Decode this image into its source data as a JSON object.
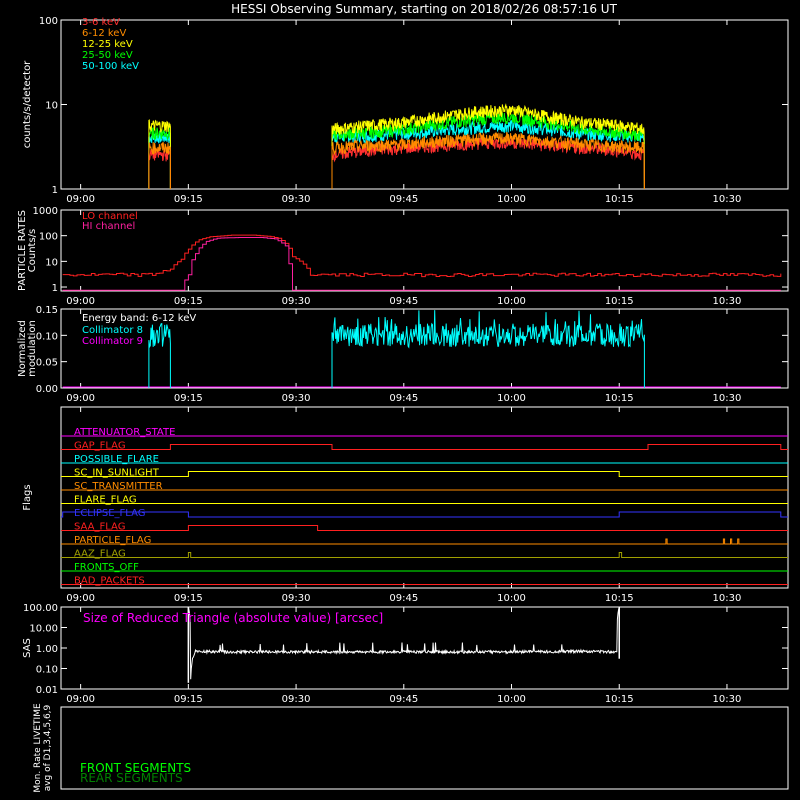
{
  "title": "HESSI Observing Summary, starting on 2018/02/26 08:57:16 UT",
  "time_axis": {
    "start": "08:57:16",
    "ticks": [
      "09:00",
      "09:15",
      "09:30",
      "09:45",
      "10:00",
      "10:15",
      "10:30"
    ]
  },
  "colors": {
    "background": "#000000",
    "axes": "#ffffff",
    "band_3_6": "#ff3030",
    "band_6_12": "#ff8c00",
    "band_12_25": "#ffff00",
    "band_25_50": "#00ff00",
    "band_50_100": "#00ffff",
    "lo_channel": "#ff2020",
    "hi_channel": "#ff20a0",
    "collimator_8": "#00ffff",
    "collimator_9": "#ff00ff",
    "sas": "#ffffff",
    "front_segments": "#00ff00",
    "rear_segments": "#008000"
  },
  "chart_data": [
    {
      "type": "line",
      "panel": "lightcurves",
      "ylabel": "counts/s/detector",
      "yscale": "log",
      "ylim": [
        1,
        100
      ],
      "ytick_labels": [
        "1",
        "10",
        "100"
      ],
      "legend_position": "top-left",
      "series": [
        {
          "name": "3-6 keV",
          "color": "#ff3030",
          "x": [
            "09:09:30",
            "09:12:30",
            "09:35:00",
            "09:40:00",
            "09:45:00",
            "09:50:00",
            "09:55:00",
            "10:00:00",
            "10:05:00",
            "10:10:00",
            "10:15:00",
            "10:18:30"
          ],
          "y": [
            2.5,
            2.5,
            2.5,
            2.8,
            3.0,
            3.2,
            3.4,
            3.5,
            3.2,
            3.0,
            2.8,
            2.5
          ]
        },
        {
          "name": "6-12 keV",
          "color": "#ff8c00",
          "x": [
            "09:09:30",
            "09:12:30",
            "09:35:00",
            "09:40:00",
            "09:45:00",
            "09:50:00",
            "09:55:00",
            "10:00:00",
            "10:05:00",
            "10:10:00",
            "10:15:00",
            "10:18:30"
          ],
          "y": [
            3.0,
            3.0,
            3.0,
            3.2,
            3.3,
            3.6,
            3.8,
            3.9,
            3.6,
            3.3,
            3.1,
            3.0
          ]
        },
        {
          "name": "12-25 keV",
          "color": "#ffff00",
          "x": [
            "09:09:30",
            "09:12:30",
            "09:35:00",
            "09:40:00",
            "09:45:00",
            "09:50:00",
            "09:55:00",
            "10:00:00",
            "10:05:00",
            "10:10:00",
            "10:15:00",
            "10:18:30"
          ],
          "y": [
            5.5,
            5.5,
            5.0,
            5.5,
            6.0,
            7.0,
            8.0,
            8.5,
            7.0,
            6.0,
            5.5,
            5.0
          ]
        },
        {
          "name": "25-50 keV",
          "color": "#00ff00",
          "x": [
            "09:09:30",
            "09:12:30",
            "09:35:00",
            "09:40:00",
            "09:45:00",
            "09:50:00",
            "09:55:00",
            "10:00:00",
            "10:05:00",
            "10:10:00",
            "10:15:00",
            "10:18:30"
          ],
          "y": [
            4.5,
            4.5,
            4.3,
            4.6,
            5.0,
            5.8,
            6.5,
            7.0,
            6.0,
            5.0,
            4.6,
            4.3
          ]
        },
        {
          "name": "50-100 keV",
          "color": "#00ffff",
          "x": [
            "09:09:30",
            "09:12:30",
            "09:35:00",
            "09:40:00",
            "09:45:00",
            "09:50:00",
            "09:55:00",
            "10:00:00",
            "10:05:00",
            "10:10:00",
            "10:15:00",
            "10:18:30"
          ],
          "y": [
            4.0,
            4.0,
            4.0,
            4.2,
            4.4,
            4.8,
            5.2,
            5.5,
            5.0,
            4.4,
            4.2,
            4.0
          ]
        }
      ]
    },
    {
      "type": "line",
      "panel": "particle_rates",
      "ylabel": "PARTICLE RATES Counts/s",
      "yscale": "log",
      "ylim": [
        0.7,
        1000
      ],
      "ytick_labels": [
        "1",
        "10",
        "100",
        "1000"
      ],
      "legend_position": "top-left",
      "series": [
        {
          "name": "LO channel",
          "color": "#ff2020",
          "x": [
            "08:57:30",
            "09:00:00",
            "09:05:00",
            "09:10:00",
            "09:12:30",
            "09:14:00",
            "09:15:00",
            "09:16:30",
            "09:18:00",
            "09:21:00",
            "09:24:00",
            "09:26:00",
            "09:27:30",
            "09:28:30",
            "09:29:30",
            "09:32:00",
            "09:45:00",
            "10:00:00",
            "10:15:00",
            "10:30:00",
            "10:37:30"
          ],
          "y": [
            3,
            3,
            3,
            3,
            5,
            12,
            30,
            70,
            90,
            105,
            105,
            95,
            80,
            50,
            15,
            3,
            3,
            3,
            3,
            3,
            3
          ]
        },
        {
          "name": "HI channel",
          "color": "#ff20a0",
          "x": [
            "08:57:30",
            "09:14:00",
            "09:15:00",
            "09:16:00",
            "09:17:30",
            "09:19:00",
            "09:22:00",
            "09:25:00",
            "09:27:00",
            "09:28:30",
            "09:29:00",
            "09:29:30",
            "10:37:30"
          ],
          "y": [
            0.75,
            0.75,
            3,
            20,
            60,
            80,
            85,
            85,
            75,
            40,
            8,
            0.75,
            0.75
          ]
        }
      ]
    },
    {
      "type": "line",
      "panel": "modulation",
      "ylabel": "Normalized modulation",
      "ylim": [
        0,
        0.15
      ],
      "ytick_labels": [
        "0.00",
        "0.05",
        "0.10",
        "0.15"
      ],
      "annotation": "Energy band: 6-12 keV",
      "series": [
        {
          "name": "Collimator 8",
          "color": "#00ffff",
          "x": [
            "09:09:30",
            "09:10:00",
            "09:12:00",
            "09:12:30",
            "09:35:00",
            "09:35:30",
            "09:45:00",
            "10:00:00",
            "10:10:00",
            "10:18:00",
            "10:18:30"
          ],
          "y": [
            0.0,
            0.1,
            0.1,
            0.0,
            0.0,
            0.1,
            0.1,
            0.1,
            0.11,
            0.1,
            0.0
          ]
        },
        {
          "name": "Collimator 9",
          "color": "#ff00ff",
          "x": [
            "08:57:30",
            "10:37:30"
          ],
          "y": [
            0.0,
            0.0
          ]
        }
      ]
    },
    {
      "type": "line",
      "panel": "flags",
      "ylabel": "Flags",
      "flags": [
        {
          "name": "ATTENUATOR_STATE",
          "color": "#ff00ff",
          "on": []
        },
        {
          "name": "GAP_FLAG",
          "color": "#ff2020",
          "on": [
            [
              "09:12:30",
              "09:35:00"
            ],
            [
              "10:19:00",
              "10:37:30"
            ]
          ]
        },
        {
          "name": "POSSIBLE_FLARE",
          "color": "#00ffff",
          "on": []
        },
        {
          "name": "SC_IN_SUNLIGHT",
          "color": "#ffff00",
          "on": [
            [
              "09:15:00",
              "10:15:00"
            ]
          ]
        },
        {
          "name": "SC_TRANSMITTER",
          "color": "#ff8c00",
          "on": []
        },
        {
          "name": "FLARE_FLAG",
          "color": "#ffff00",
          "on": []
        },
        {
          "name": "ECLIPSE_FLAG",
          "color": "#3333ff",
          "on": [
            [
              "08:57:30",
              "09:15:00"
            ],
            [
              "10:15:00",
              "10:37:30"
            ]
          ]
        },
        {
          "name": "SAA_FLAG",
          "color": "#ff2020",
          "on": [
            [
              "09:15:00",
              "09:33:00"
            ]
          ]
        },
        {
          "name": "PARTICLE_FLAG",
          "color": "#ff8c00",
          "on": [
            [
              "10:21:30",
              "10:21:40"
            ],
            [
              "10:29:30",
              "10:29:40"
            ],
            [
              "10:30:30",
              "10:30:40"
            ],
            [
              "10:31:30",
              "10:31:40"
            ]
          ]
        },
        {
          "name": "AAZ_FLAG",
          "color": "#a0a000",
          "on": [
            [
              "09:15:00",
              "09:15:20"
            ],
            [
              "10:15:00",
              "10:15:20"
            ]
          ]
        },
        {
          "name": "FRONTS_OFF",
          "color": "#00ff00",
          "on": []
        },
        {
          "name": "BAD_PACKETS",
          "color": "#ff2020",
          "on": []
        }
      ]
    },
    {
      "type": "line",
      "panel": "sas",
      "ylabel": "SAS",
      "yscale": "log",
      "ylim": [
        0.01,
        100
      ],
      "ytick_labels": [
        "0.01",
        "0.10",
        "1.00",
        "10.00",
        "100.00"
      ],
      "annotation": "Size of Reduced Triangle (absolute value) [arcsec]",
      "series": [
        {
          "color": "#ffffff",
          "x": [
            "09:15:00",
            "09:15:20",
            "09:16:00",
            "09:20:00",
            "09:30:00",
            "09:45:00",
            "10:00:00",
            "10:10:00",
            "10:14:40",
            "10:15:00"
          ],
          "y": [
            100,
            0.03,
            0.7,
            0.65,
            0.65,
            0.65,
            0.65,
            0.7,
            0.65,
            100
          ]
        }
      ]
    },
    {
      "type": "line",
      "panel": "livetime",
      "ylabel": "Mon. Rate LIVETIME avg of D1,3,4,5,6,9",
      "ylim": [
        0,
        1
      ],
      "legend_position": "bottom-left",
      "series": [
        {
          "name": "FRONT SEGMENTS",
          "color": "#00ff00",
          "x": [],
          "y": []
        },
        {
          "name": "REAR SEGMENTS",
          "color": "#008000",
          "x": [],
          "y": []
        }
      ]
    }
  ]
}
